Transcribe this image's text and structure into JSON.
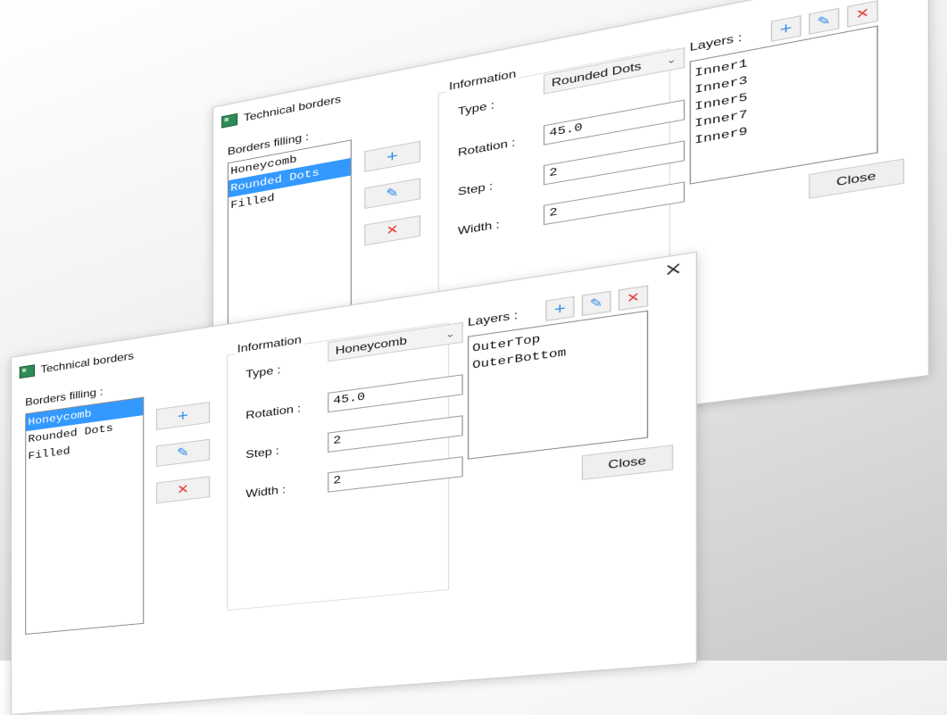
{
  "back_dialog": {
    "title": "Technical borders",
    "close_symbol": "×",
    "borders_filling": {
      "label": "Borders filling :",
      "items": [
        "Honeycomb",
        "Rounded Dots",
        "Filled"
      ],
      "selected_index": 1
    },
    "buttons": {
      "add": "+",
      "edit": "✎",
      "delete": "✕"
    },
    "information": {
      "title": "Information",
      "type_label": "Type :",
      "type_value": "Rounded Dots",
      "rotation_label": "Rotation :",
      "rotation_value": "45.0",
      "step_label": "Step :",
      "step_value": "2",
      "width_label": "Width :",
      "width_value": "2"
    },
    "layers": {
      "label": "Layers :",
      "items": [
        "Inner1",
        "Inner3",
        "Inner5",
        "Inner7",
        "Inner9"
      ]
    },
    "close_label": "Close"
  },
  "front_dialog": {
    "title": "Technical borders",
    "close_symbol": "×",
    "borders_filling": {
      "label": "Borders filling :",
      "items": [
        "Honeycomb",
        "Rounded Dots",
        "Filled"
      ],
      "selected_index": 0
    },
    "buttons": {
      "add": "+",
      "edit": "✎",
      "delete": "✕"
    },
    "information": {
      "title": "Information",
      "type_label": "Type :",
      "type_value": "Honeycomb",
      "rotation_label": "Rotation :",
      "rotation_value": "45.0",
      "step_label": "Step :",
      "step_value": "2",
      "width_label": "Width :",
      "width_value": "2"
    },
    "layers": {
      "label": "Layers :",
      "items": [
        "OuterTop",
        "OuterBottom"
      ]
    },
    "close_label": "Close"
  },
  "colors": {
    "selection": "#3399ff",
    "add_edit_icon": "#2b8ce6",
    "delete_icon": "#e53935"
  },
  "icons": {
    "add": "plus-icon",
    "edit": "pencil-icon",
    "delete": "x-icon",
    "window_close": "close-icon",
    "dropdown": "chevron-down-icon",
    "app": "technical-borders-app-icon"
  }
}
